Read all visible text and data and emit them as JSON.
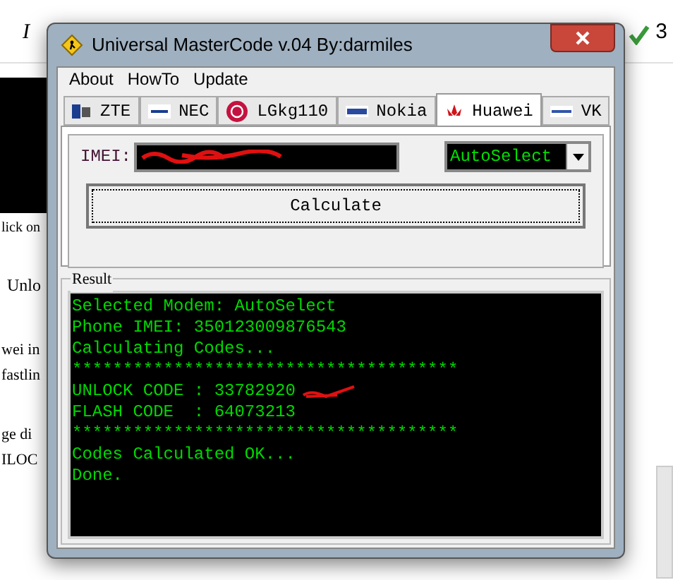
{
  "background_document": {
    "toolbar_texts": [
      "I",
      "3"
    ],
    "lines": [
      "lick on",
      "Unlo",
      "wei in",
      "fastlin",
      "ge di",
      "ILOC"
    ]
  },
  "window": {
    "title": "Universal MasterCode v.04 By:darmiles"
  },
  "menu": [
    "About",
    "HowTo",
    "Update"
  ],
  "tabs": [
    {
      "label": "ZTE",
      "selected": false
    },
    {
      "label": "NEC",
      "selected": false
    },
    {
      "label": "LGkg110",
      "selected": false
    },
    {
      "label": "Nokia",
      "selected": false
    },
    {
      "label": "Huawei",
      "selected": true
    },
    {
      "label": "VK",
      "selected": false
    }
  ],
  "imei": {
    "label": "IMEI:"
  },
  "modem_select": {
    "value": "AutoSelect"
  },
  "calculate_button": "Calculate",
  "result": {
    "title": "Result",
    "lines": [
      {
        "text": "Selected Modem: AutoSelect",
        "annotated": false
      },
      {
        "text": "Phone IMEI: 350123009876543",
        "annotated": false
      },
      {
        "text": "Calculating Codes...",
        "annotated": false
      },
      {
        "text": "**************************************",
        "annotated": false
      },
      {
        "text": "UNLOCK CODE : 33782920",
        "annotated": true
      },
      {
        "text": "FLASH CODE  : 64073213",
        "annotated": false
      },
      {
        "text": "**************************************",
        "annotated": false
      },
      {
        "text": "Codes Calculated OK...",
        "annotated": false
      },
      {
        "text": "Done.",
        "annotated": false
      }
    ]
  }
}
